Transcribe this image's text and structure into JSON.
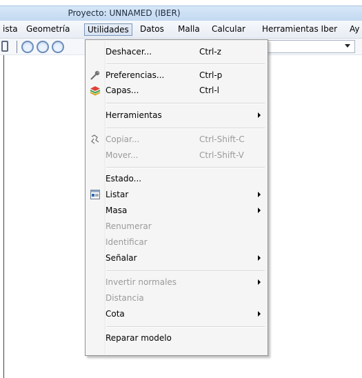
{
  "window": {
    "title": "Proyecto: UNNAMED (IBER)"
  },
  "menubar": [
    {
      "label": "ista"
    },
    {
      "label": "Geometría"
    },
    {
      "label": "Utilidades"
    },
    {
      "label": "Datos"
    },
    {
      "label": "Malla"
    },
    {
      "label": "Calcular"
    },
    {
      "label": "Herramientas Iber"
    },
    {
      "label": "Ay"
    }
  ],
  "dropdown": {
    "items": [
      {
        "label": "Deshacer...",
        "accel": "Ctrl-z",
        "icon": ""
      },
      {
        "label": "Preferencias...",
        "accel": "Ctrl-p",
        "icon": "preferences-icon"
      },
      {
        "label": "Capas...",
        "accel": "Ctrl-l",
        "icon": "layers-icon"
      },
      {
        "label": "Herramientas",
        "submenu": true
      },
      {
        "label": "Copiar...",
        "accel": "Ctrl-Shift-C",
        "disabled": true,
        "icon": "copy-icon"
      },
      {
        "label": "Mover...",
        "accel": "Ctrl-Shift-V",
        "disabled": true
      },
      {
        "label": "Estado..."
      },
      {
        "label": "Listar",
        "submenu": true,
        "icon": "list-icon"
      },
      {
        "label": "Masa",
        "submenu": true
      },
      {
        "label": "Renumerar",
        "disabled": true
      },
      {
        "label": "Identificar",
        "disabled": true
      },
      {
        "label": "Señalar",
        "submenu": true
      },
      {
        "label": "Invertir normales",
        "submenu": true,
        "disabled": true
      },
      {
        "label": "Distancia",
        "disabled": true
      },
      {
        "label": "Cota",
        "submenu": true
      },
      {
        "label": "Reparar modelo"
      }
    ]
  }
}
